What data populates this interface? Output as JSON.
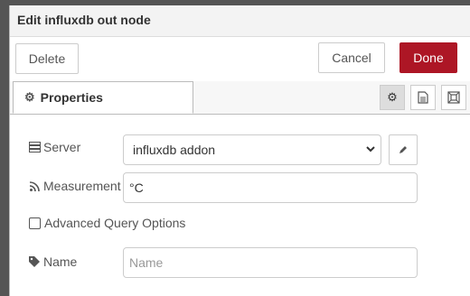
{
  "dialog": {
    "title": "Edit influxdb out node"
  },
  "toolbar": {
    "delete_label": "Delete",
    "cancel_label": "Cancel",
    "done_label": "Done"
  },
  "tabs": {
    "properties_label": "Properties"
  },
  "form": {
    "server_label": "Server",
    "server_value": "influxdb addon",
    "measurement_label": "Measurement",
    "measurement_value": "°C",
    "advanced_label": "Advanced Query Options",
    "name_label": "Name",
    "name_placeholder": "Name"
  },
  "colors": {
    "primary": "#ad1625"
  }
}
